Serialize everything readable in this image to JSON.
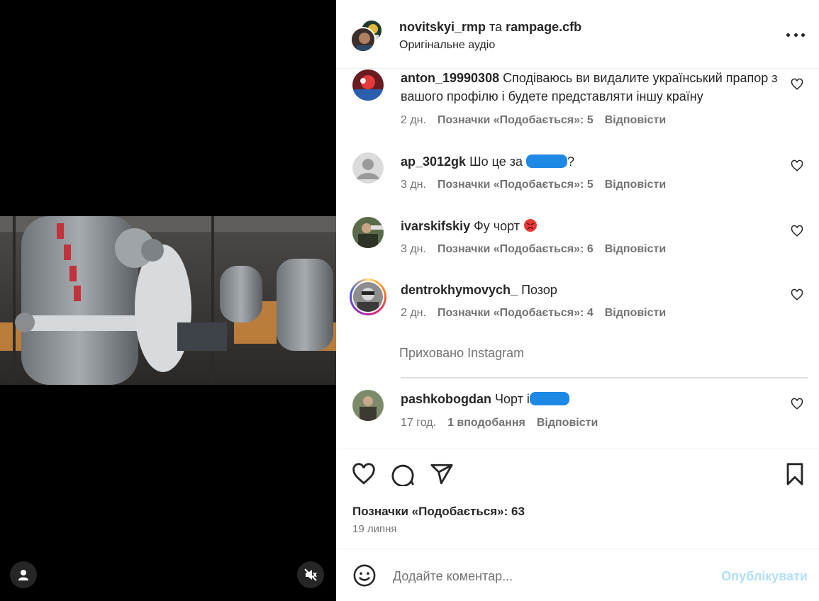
{
  "header": {
    "user1": "novitskyi_rmp",
    "conjunction": "та",
    "user2": "rampage.cfb",
    "audio": "Оригінальне аудіо"
  },
  "comments": [
    {
      "username": "anton_19990308",
      "text": "Сподіваюсь ви видалите український прапор з вашого профілю і будете представляти іншу країну",
      "time": "2 дн.",
      "likes": "Позначки «Подобається»: 5",
      "reply": "Відповісти"
    },
    {
      "username": "ap_3012gk",
      "text": "Шо це за",
      "text_after": "?",
      "time": "3 дн.",
      "likes": "Позначки «Подобається»: 5",
      "reply": "Відповісти"
    },
    {
      "username": "ivarskifskiy",
      "text": "Фу чорт",
      "time": "3 дн.",
      "likes": "Позначки «Подобається»: 6",
      "reply": "Відповісти"
    },
    {
      "username": "dentrokhymovych_",
      "text": "Позор",
      "time": "2 дн.",
      "likes": "Позначки «Подобається»: 4",
      "reply": "Відповісти"
    },
    {
      "username": "pashkobogdan",
      "text": "Чорт і",
      "time": "17 год.",
      "likes": "1 вподобання",
      "reply": "Відповісти"
    }
  ],
  "hidden_label": "Приховано Instagram",
  "post": {
    "likes": "Позначки «Подобається»: 63",
    "date": "19 липня"
  },
  "comment_box": {
    "placeholder": "Додайте коментар...",
    "publish": "Опублікувати"
  },
  "colors": {
    "text": "#262626",
    "secondary": "#737373",
    "publish_disabled": "#b2dffc",
    "redaction": "#1e88e5"
  }
}
